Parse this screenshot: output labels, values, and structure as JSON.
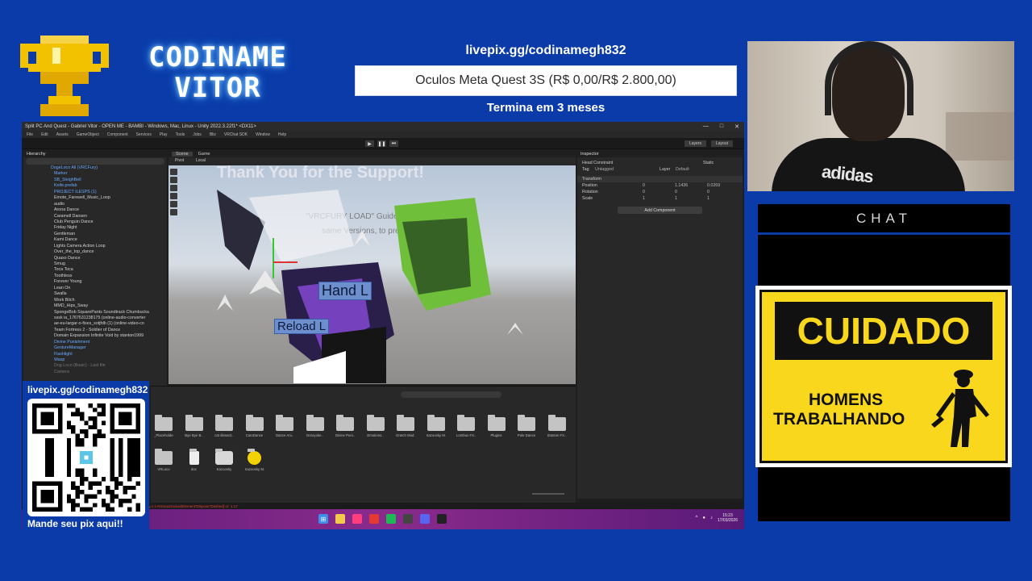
{
  "brand": {
    "line1": "CODINAME",
    "line2": "VITOR"
  },
  "goal": {
    "url": "livepix.gg/codinamegh832",
    "title": "Oculos Meta Quest 3S (R$ 0,00/R$ 2.800,00)",
    "ends": "Termina em 3 meses"
  },
  "webcam": {
    "shirt_text": "adidas"
  },
  "chat": {
    "title": "CHAT"
  },
  "sign": {
    "heading": "CUIDADO",
    "line1": "HOMENS",
    "line2": "TRABALHANDO"
  },
  "qr": {
    "url": "livepix.gg/codinamegh832",
    "caption": "Mande seu pix aqui!!"
  },
  "unity": {
    "title": "Split PC And Quest - Gabriel Vitor - OPEN ME - BAMBI - Windows, Mac, Linux - Unity 2022.3.22f1* <DX11>",
    "menu": [
      "File",
      "Edit",
      "Assets",
      "GameObject",
      "Component",
      "Services",
      "Play",
      "Tools",
      "Jobs",
      "Bliz",
      "VRChat SDK",
      "Window",
      "Help"
    ],
    "toolbar_right": [
      "Layers",
      "Layout"
    ],
    "hierarchy_tab": "Hierarchy",
    "hierarchy_items": [
      "DogeLoco All (VRCFury)",
      "Marker",
      "SB_SleighBell",
      "Knife.prefab",
      "PROJECT ILESPS (1)",
      "Emote_Farewell_Music_Loop",
      "audio",
      "Arona Dance",
      "Caramell Dansen",
      "Club Penguin Dance",
      "Friday Night",
      "Gentleman",
      "Kami Dance",
      "Lights Camera Action Loop",
      "Over_the_top_dance",
      "Quaxo Dance",
      "Smug",
      "Toca Toca",
      "Toothless",
      "Forever Young",
      "Lean On",
      "Swalla",
      "Work Bitch",
      "MMD_Hips_Sway",
      "SpongeBob SquarePants Soundtrack Chumbucka",
      "sssk ia_1767631238175 (online-audio-converter",
      "ae-eu-largar-o-fixes_sotjfdb (1) (online-video-co",
      "Team Fortress 2 - Soldier of Dance",
      "Domain Expansion Infinite Void by stanton1999",
      "Divine Punishment",
      "GestureManager",
      "Flashlight",
      "Wasp",
      "Dog Loco (Basic) - Last file",
      "Camera"
    ],
    "scene_tabs": [
      "Scene",
      "Game"
    ],
    "scene_tools": [
      "Pivot",
      "Local"
    ],
    "scene_text": {
      "banner": "Thank You for the Support!",
      "line2": "\"VRCFURY LOAD\" Guide and make sure to",
      "line3": "same Versions, to prevent errors."
    },
    "scene_labels": {
      "hand": "Hand L",
      "reload": "Reload L"
    },
    "inspector": {
      "tab": "Inspector",
      "object_name": "Head Constraint",
      "static": "Static",
      "tag_label": "Tag",
      "tag_value": "Untagged",
      "layer_label": "Layer",
      "layer_value": "Default",
      "component": "Transform",
      "rows": [
        {
          "label": "Position",
          "x": "0",
          "y": "1.1436",
          "z": "0.0269"
        },
        {
          "label": "Rotation",
          "x": "0",
          "y": "0",
          "z": "0"
        },
        {
          "label": "Scale",
          "x": "1",
          "y": "1",
          "z": "1"
        }
      ],
      "add_component": "Add Component"
    },
    "project_folders": [
      "_Placeholder",
      "Bye Bye B..",
      "cat dissecti..",
      "CutoDance",
      "Dance Ani..",
      "Doroyoke..",
      "Divine Puni..",
      "Emotions..",
      "Gratch Mod..",
      "Kazoosky M..",
      "Lombox FX..",
      "Plugins",
      "Pole Dance",
      "Stanton FX..",
      "VRLoco",
      "doc",
      "Kazoosky",
      "Kazoosky M.."
    ],
    "status_text": "Set Transforms [Unity: Library.4.1-RSmaLDockedElement\"Dispose\"Dashed] or: 1.17",
    "clock": {
      "time": "15:23",
      "date": "17/03/2026"
    }
  }
}
